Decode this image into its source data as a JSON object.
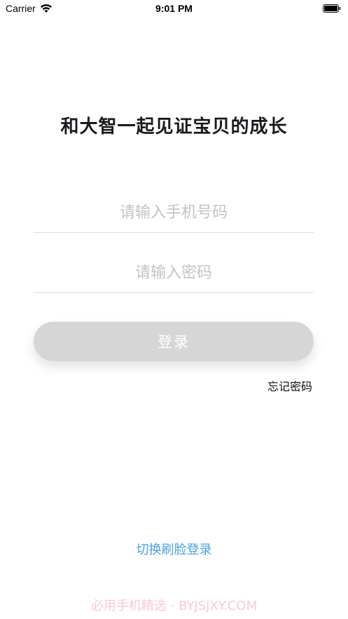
{
  "status_bar": {
    "carrier": "Carrier",
    "time": "9:01 PM"
  },
  "title": "和大智一起见证宝贝的成长",
  "phone_field": {
    "placeholder": "请输入手机号码",
    "value": ""
  },
  "password_field": {
    "placeholder": "请输入密码",
    "value": ""
  },
  "login_button_label": "登录",
  "forgot_password_label": "忘记密码",
  "face_login_label": "切换刷脸登录",
  "watermark": "必用手机精选 · BYJSJXY.COM",
  "colors": {
    "accent": "#4a9fe0",
    "button_disabled": "#d6d6d6",
    "divider": "#dcdcdc",
    "placeholder": "#c3c3c3"
  }
}
